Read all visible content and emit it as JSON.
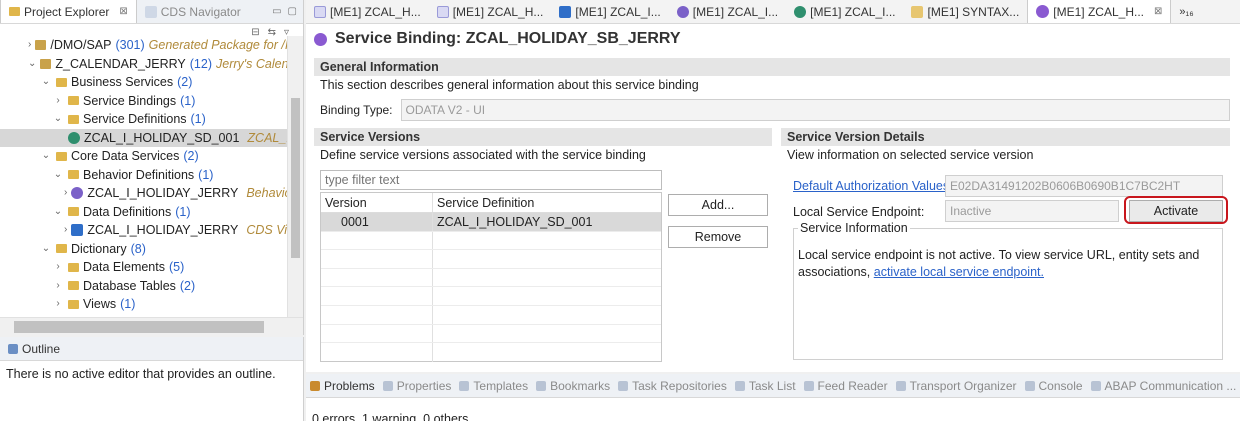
{
  "explorer": {
    "tabs": [
      {
        "label": "Project Explorer",
        "close": "⊠",
        "active": true
      },
      {
        "label": "CDS Navigator",
        "active": false
      }
    ],
    "tree": [
      {
        "indent": 2,
        "arrow": "›",
        "icon": "pkg",
        "label": "/DMO/SAP",
        "count": "(301)",
        "desc": "Generated Package for /I"
      },
      {
        "indent": 2,
        "arrow": "⌄",
        "icon": "pkg",
        "label": "Z_CALENDAR_JERRY",
        "count": "(12)",
        "desc": "Jerry's Calendar"
      },
      {
        "indent": 3,
        "arrow": "⌄",
        "icon": "folder",
        "label": "Business Services",
        "count": "(2)",
        "desc": ""
      },
      {
        "indent": 4,
        "arrow": "›",
        "icon": "folder",
        "label": "Service Bindings",
        "count": "(1)",
        "desc": ""
      },
      {
        "indent": 4,
        "arrow": "⌄",
        "icon": "folder",
        "label": "Service Definitions",
        "count": "(1)",
        "desc": ""
      },
      {
        "indent": 5,
        "arrow": "",
        "icon": "cds",
        "label": "ZCAL_I_HOLIDAY_SD_001",
        "count": "",
        "desc": "ZCAL_I",
        "sel": true
      },
      {
        "indent": 3,
        "arrow": "⌄",
        "icon": "folder",
        "label": "Core Data Services",
        "count": "(2)",
        "desc": ""
      },
      {
        "indent": 4,
        "arrow": "⌄",
        "icon": "folder",
        "label": "Behavior Definitions",
        "count": "(1)",
        "desc": ""
      },
      {
        "indent": 5,
        "arrow": "›",
        "icon": "bdef",
        "label": "ZCAL_I_HOLIDAY_JERRY",
        "count": "",
        "desc": "Behavior"
      },
      {
        "indent": 4,
        "arrow": "⌄",
        "icon": "folder",
        "label": "Data Definitions",
        "count": "(1)",
        "desc": ""
      },
      {
        "indent": 5,
        "arrow": "›",
        "icon": "ddef",
        "label": "ZCAL_I_HOLIDAY_JERRY",
        "count": "",
        "desc": "CDS View"
      },
      {
        "indent": 3,
        "arrow": "⌄",
        "icon": "folder",
        "label": "Dictionary",
        "count": "(8)",
        "desc": ""
      },
      {
        "indent": 4,
        "arrow": "›",
        "icon": "folder",
        "label": "Data Elements",
        "count": "(5)",
        "desc": ""
      },
      {
        "indent": 4,
        "arrow": "›",
        "icon": "folder",
        "label": "Database Tables",
        "count": "(2)",
        "desc": ""
      },
      {
        "indent": 4,
        "arrow": "›",
        "icon": "folder",
        "label": "Views",
        "count": "(1)",
        "desc": ""
      }
    ]
  },
  "outline": {
    "tab": "Outline",
    "message": "There is no active editor that provides an outline."
  },
  "editor_tabs": [
    {
      "label": "[ME1] ZCAL_H...",
      "icon": "editor"
    },
    {
      "label": "[ME1] ZCAL_H...",
      "icon": "editor"
    },
    {
      "label": "[ME1] ZCAL_I...",
      "icon": "ddef"
    },
    {
      "label": "[ME1] ZCAL_I...",
      "icon": "bdef"
    },
    {
      "label": "[ME1] ZCAL_I...",
      "icon": "cds"
    },
    {
      "label": "[ME1] SYNTAX...",
      "icon": "syntax"
    },
    {
      "label": "[ME1] ZCAL_H...",
      "icon": "binding",
      "active": true
    }
  ],
  "editor_overflow": "»₁₆",
  "editor": {
    "title": "Service Binding: ZCAL_HOLIDAY_SB_JERRY",
    "general": {
      "header": "General Information",
      "description": "This section describes general information about this service binding",
      "binding_type_label": "Binding Type:",
      "binding_type_value": "ODATA V2 - UI"
    },
    "versions": {
      "header": "Service Versions",
      "description": "Define service versions associated with the service binding",
      "filter_placeholder": "type filter text",
      "col_version": "Version",
      "col_definition": "Service Definition",
      "rows": [
        {
          "version": "0001",
          "definition": "ZCAL_I_HOLIDAY_SD_001"
        }
      ],
      "add_label": "Add...",
      "remove_label": "Remove"
    },
    "details": {
      "header": "Service Version Details",
      "description": "View information on selected service version",
      "auth_link": "Default Authorization Values:",
      "auth_value": "E02DA31491202B0606B0690B1C7BC2HT",
      "endpoint_label": "Local Service Endpoint:",
      "endpoint_value": "Inactive",
      "activate_label": "Activate",
      "info_title": "Service Information",
      "info_text": "Local service endpoint is not active. To view service URL, entity sets and associations,",
      "info_link": "activate local service endpoint."
    }
  },
  "problems": {
    "tabs": [
      {
        "label": "Problems",
        "active": true
      },
      {
        "label": "Properties"
      },
      {
        "label": "Templates"
      },
      {
        "label": "Bookmarks"
      },
      {
        "label": "Task Repositories"
      },
      {
        "label": "Task List"
      },
      {
        "label": "Feed Reader"
      },
      {
        "label": "Transport Organizer"
      },
      {
        "label": "Console"
      },
      {
        "label": "ABAP Communication ..."
      }
    ],
    "summary": "0 errors, 1 warning, 0 others"
  },
  "colors": {
    "highlight": "#c8161d",
    "link": "#2a62c9"
  }
}
